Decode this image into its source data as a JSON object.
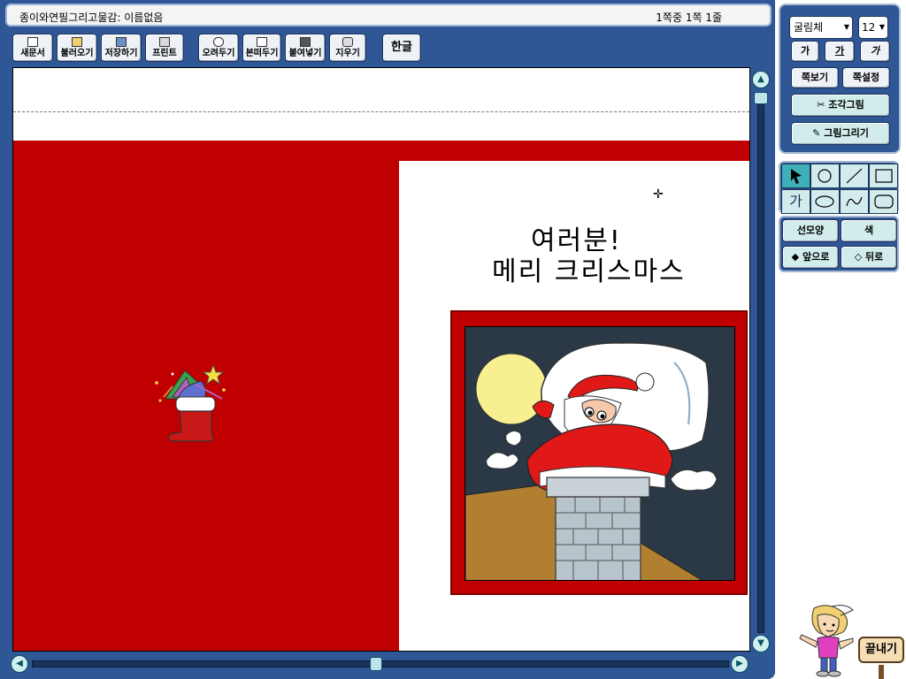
{
  "window": {
    "title": "종이와연필그리고물감: 이름없음",
    "status": "1쪽중 1쪽 1줄"
  },
  "toolbar": {
    "new": "새문서",
    "open": "불러오기",
    "save": "저장하기",
    "print": "프린트",
    "cut": "오려두기",
    "copy": "본떠두기",
    "paste": "붙여넣기",
    "erase": "지우기",
    "hangul": "한글"
  },
  "document": {
    "greeting_line1": "여러분!",
    "greeting_line2": "메리 크리스마스",
    "cursor": "✛"
  },
  "format_panel": {
    "font_value": "굴림체",
    "size_value": "12",
    "bold": "가",
    "underline": "가",
    "italic": "가",
    "page_view": "쪽보기",
    "page_setup": "쪽설정",
    "clip_art": "조각그림",
    "draw": "그림그리기"
  },
  "tools": {
    "text_tool": "가"
  },
  "shape_panel": {
    "line_style": "선모양",
    "color": "색",
    "bring_front": "앞으로",
    "send_back": "뒤로"
  },
  "exit": {
    "label": "끝내기"
  },
  "colors": {
    "frame_blue": "#2f5796",
    "card_red": "#c00000",
    "tool_teal": "#3fb0b8"
  }
}
